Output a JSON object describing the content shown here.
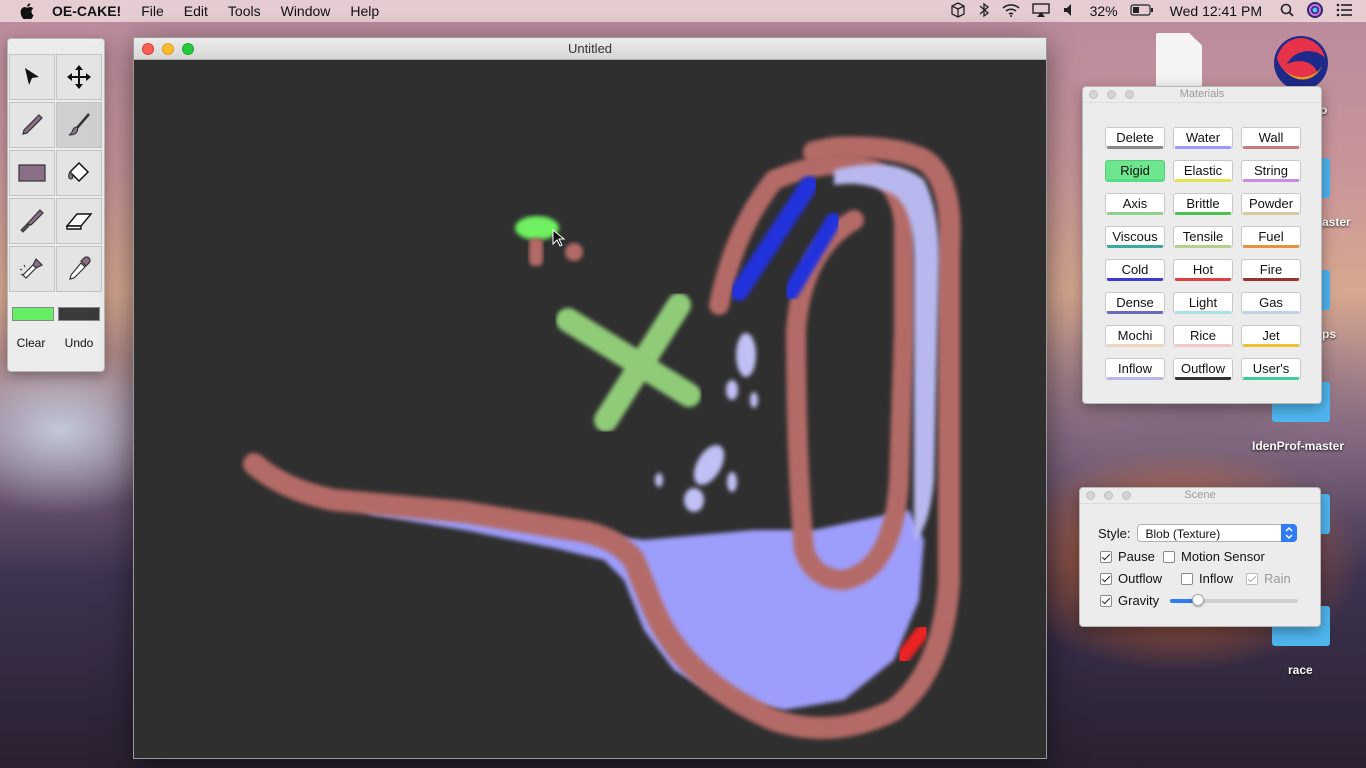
{
  "menubar": {
    "app_name": "OE-CAKE!",
    "menus": [
      "File",
      "Edit",
      "Tools",
      "Window",
      "Help"
    ],
    "battery": "32%",
    "clock": "Wed 12:41 PM"
  },
  "toolbox": {
    "tools": [
      "pointer-tool",
      "move-tool",
      "pencil-tool",
      "brush-tool",
      "rectangle-tool",
      "fill-bucket-tool",
      "knife-tool",
      "eraser-tool",
      "flashlight-tool",
      "dropper-tool"
    ],
    "primary_color": "#66ee66",
    "secondary_color": "#3a3a3a",
    "clear_label": "Clear",
    "undo_label": "Undo"
  },
  "window": {
    "title": "Untitled"
  },
  "materials": {
    "title": "Materials",
    "buttons": [
      {
        "label": "Delete",
        "color": "#888888"
      },
      {
        "label": "Water",
        "color": "#9a9aff"
      },
      {
        "label": "Wall",
        "color": "#c57b7b"
      },
      {
        "label": "Rigid",
        "color": "#55dd88",
        "selected": true
      },
      {
        "label": "Elastic",
        "color": "#e6e24a"
      },
      {
        "label": "String",
        "color": "#c98be6"
      },
      {
        "label": "Axis",
        "color": "#8fd08f"
      },
      {
        "label": "Brittle",
        "color": "#4ec24e"
      },
      {
        "label": "Powder",
        "color": "#d8c9a0"
      },
      {
        "label": "Viscous",
        "color": "#3aa9a0"
      },
      {
        "label": "Tensile",
        "color": "#b5d08a"
      },
      {
        "label": "Fuel",
        "color": "#e69040"
      },
      {
        "label": "Cold",
        "color": "#3a3ad6"
      },
      {
        "label": "Hot",
        "color": "#e04040"
      },
      {
        "label": "Fire",
        "color": "#a03030"
      },
      {
        "label": "Dense",
        "color": "#6a6ab8"
      },
      {
        "label": "Light",
        "color": "#a8e0e8"
      },
      {
        "label": "Gas",
        "color": "#c0d0e8"
      },
      {
        "label": "Mochi",
        "color": "#f0d8c0"
      },
      {
        "label": "Rice",
        "color": "#f0c8c8"
      },
      {
        "label": "Jet",
        "color": "#f0c030"
      },
      {
        "label": "Inflow",
        "color": "#b8b8e8"
      },
      {
        "label": "Outflow",
        "color": "#333333"
      },
      {
        "label": "User's",
        "color": "#3acf9a"
      }
    ]
  },
  "scene": {
    "title": "Scene",
    "style_label": "Style:",
    "style_value": "Blob (Texture)",
    "pause_label": "Pause",
    "pause_checked": true,
    "motion_sensor_label": "Motion Sensor",
    "motion_sensor_checked": false,
    "outflow_label": "Outflow",
    "outflow_checked": true,
    "inflow_label": "Inflow",
    "inflow_checked": false,
    "rain_label": "Rain",
    "rain_checked": true,
    "gravity_label": "Gravity",
    "gravity_checked": true,
    "gravity_level": 0.22
  },
  "desktop": {
    "labels": [
      "o",
      "aster",
      "ps",
      "IdenProf-master",
      "race"
    ]
  }
}
